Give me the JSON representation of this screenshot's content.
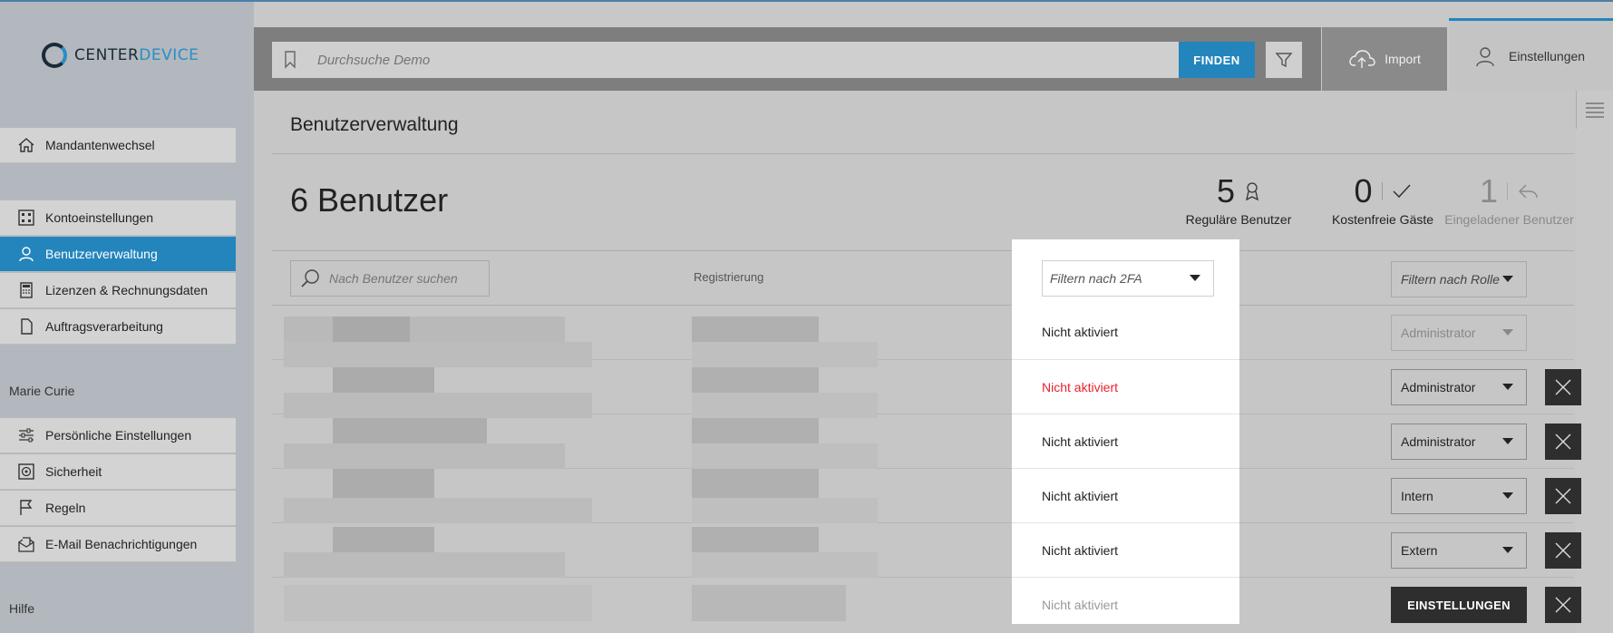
{
  "app": {
    "logo_part1": "CENTER",
    "logo_part2": "DEVICE",
    "brand_color": "#2485bd"
  },
  "search": {
    "placeholder": "Durchsuche Demo",
    "button_label": "FINDEN"
  },
  "topnav": {
    "import_label": "Import",
    "settings_label": "Einstellungen"
  },
  "sidebar": {
    "top_items": [
      {
        "label": "Mandantenwechsel",
        "icon": "home-icon"
      }
    ],
    "account_items": [
      {
        "label": "Kontoeinstellungen",
        "icon": "grid-icon",
        "active": false
      },
      {
        "label": "Benutzerverwaltung",
        "icon": "user-icon",
        "active": true
      },
      {
        "label": "Lizenzen & Rechnungsdaten",
        "icon": "calculator-icon",
        "active": false
      },
      {
        "label": "Auftragsverarbeitung",
        "icon": "document-icon",
        "active": false
      }
    ],
    "user_section": "Marie Curie",
    "user_items": [
      {
        "label": "Persönliche Einstellungen",
        "icon": "sliders-icon"
      },
      {
        "label": "Sicherheit",
        "icon": "safe-icon"
      },
      {
        "label": "Regeln",
        "icon": "flag-icon"
      },
      {
        "label": "E-Mail Benachrichtigungen",
        "icon": "mail-icon"
      }
    ],
    "help_section": "Hilfe"
  },
  "main": {
    "page_title": "Benutzerverwaltung",
    "user_count_title": "6 Benutzer",
    "stats": [
      {
        "value": "5",
        "label": "Reguläre Benutzer",
        "icon": "award-icon"
      },
      {
        "value": "0",
        "label": "Kostenfreie Gäste",
        "icon": "check-icon"
      },
      {
        "value": "1",
        "label": "Eingeladener Benutzer",
        "icon": "reply-icon"
      }
    ],
    "user_search_placeholder": "Nach Benutzer suchen",
    "registration_header": "Registrierung",
    "twofa_filter_placeholder": "Filtern nach 2FA",
    "role_filter_placeholder": "Filtern nach Rolle",
    "rows": [
      {
        "twofa": "Nicht aktiviert",
        "role": "Administrator"
      },
      {
        "twofa": "Nicht aktiviert",
        "role": "Administrator"
      },
      {
        "twofa": "Nicht aktiviert",
        "role": "Administrator"
      },
      {
        "twofa": "Nicht aktiviert",
        "role": "Intern"
      },
      {
        "twofa": "Nicht aktiviert",
        "role": "Extern"
      },
      {
        "twofa": "Nicht aktiviert",
        "role": "EINSTELLUNGEN"
      }
    ],
    "twofa_alert_color": "#e8202f"
  }
}
